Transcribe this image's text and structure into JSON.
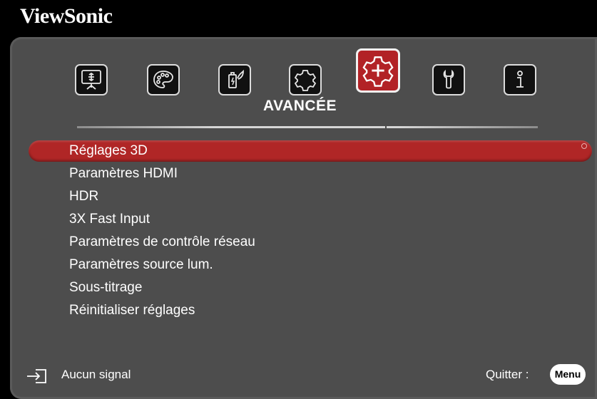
{
  "brand": "ViewSonic",
  "tabs": [
    {
      "icon": "display-icon",
      "active": false
    },
    {
      "icon": "palette-icon",
      "active": false
    },
    {
      "icon": "power-battery-icon",
      "active": false
    },
    {
      "icon": "gear-icon",
      "active": false
    },
    {
      "icon": "advanced-gear-plus-icon",
      "active": true
    },
    {
      "icon": "wrench-icon",
      "active": false
    },
    {
      "icon": "info-icon",
      "active": false
    }
  ],
  "active_tab_title": "AVANCÉE",
  "menu": {
    "items": [
      {
        "label": "Réglages 3D",
        "selected": true
      },
      {
        "label": "Paramètres HDMI",
        "selected": false
      },
      {
        "label": "HDR",
        "selected": false
      },
      {
        "label": "3X Fast Input",
        "selected": false
      },
      {
        "label": "Paramètres de contrôle réseau",
        "selected": false
      },
      {
        "label": "Paramètres source lum.",
        "selected": false
      },
      {
        "label": "Sous-titrage",
        "selected": false
      },
      {
        "label": "Réinitialiser réglages",
        "selected": false
      }
    ]
  },
  "footer": {
    "status_icon": "input-source-icon",
    "status_text": "Aucun signal",
    "quit_label": "Quitter :",
    "menu_key": "Menu"
  },
  "colors": {
    "accent": "#b02626",
    "panel": "#4d4d4d",
    "background": "#000000"
  }
}
